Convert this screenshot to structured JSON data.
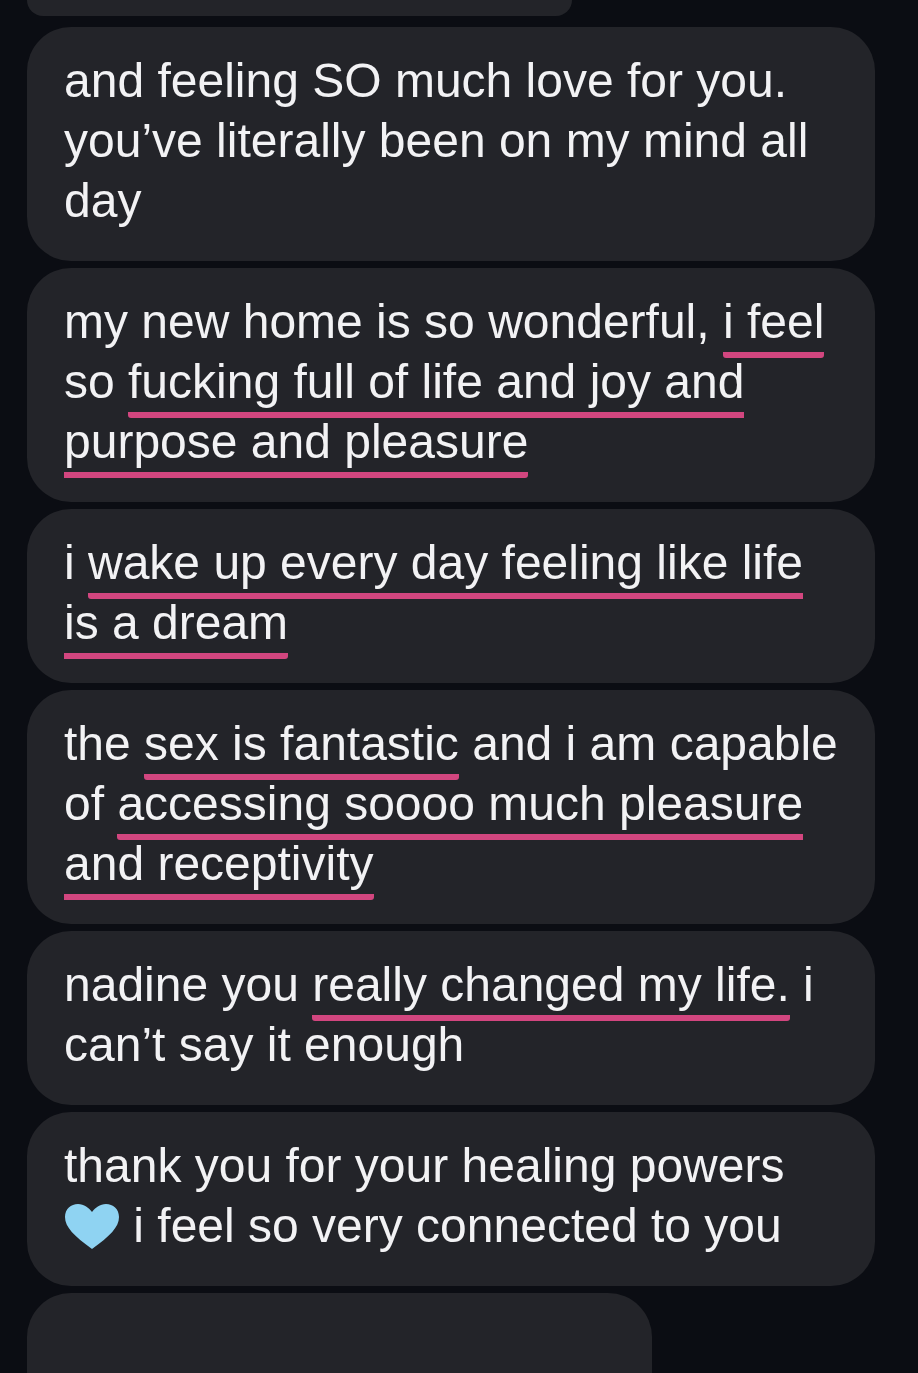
{
  "messages": [
    {
      "kind": "cut-top"
    },
    {
      "kind": "full",
      "segments": [
        {
          "text": "and feeling SO much love for you. you’ve literally been on my mind all day",
          "underlined": false
        }
      ]
    },
    {
      "kind": "full",
      "segments": [
        {
          "text": "my new home is so wonderful, ",
          "underlined": false
        },
        {
          "text": "i feel",
          "underlined": true
        },
        {
          "text": " so ",
          "underlined": false
        },
        {
          "text": "fucking full of life and joy and purpose and pleasure",
          "underlined": true
        }
      ]
    },
    {
      "kind": "full",
      "segments": [
        {
          "text": "i ",
          "underlined": false
        },
        {
          "text": "wake up every day feeling like life is a dream",
          "underlined": true
        }
      ]
    },
    {
      "kind": "full",
      "segments": [
        {
          "text": "the ",
          "underlined": false
        },
        {
          "text": "sex is fantastic",
          "underlined": true
        },
        {
          "text": " and i am capable of ",
          "underlined": false
        },
        {
          "text": "accessing soooo much pleasure and receptivity",
          "underlined": true
        }
      ]
    },
    {
      "kind": "full",
      "segments": [
        {
          "text": "nadine you ",
          "underlined": false
        },
        {
          "text": "really changed my life.",
          "underlined": true
        },
        {
          "text": " i can’t say it enough",
          "underlined": false
        }
      ]
    },
    {
      "kind": "full",
      "segments": [
        {
          "text": "thank you for your healing powers ",
          "underlined": false
        },
        {
          "kind": "heart"
        },
        {
          "text": " i feel so very connected to you",
          "underlined": false
        }
      ]
    },
    {
      "kind": "cut-bottom"
    }
  ]
}
